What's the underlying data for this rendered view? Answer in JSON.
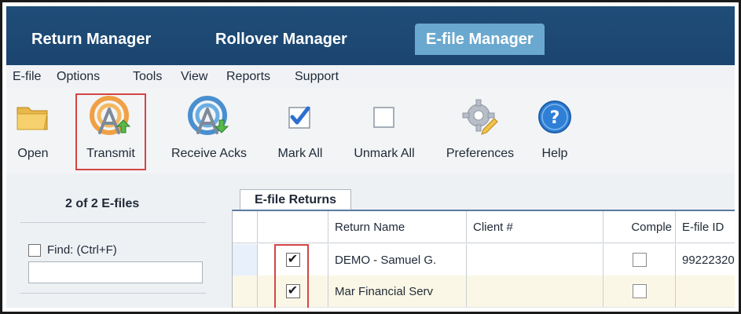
{
  "top_tabs": [
    {
      "label": "Return Manager"
    },
    {
      "label": "Rollover Manager"
    },
    {
      "label": "E-file Manager"
    }
  ],
  "menu": [
    {
      "label": "E-file"
    },
    {
      "label": "Options"
    },
    {
      "label": "Tools"
    },
    {
      "label": "View"
    },
    {
      "label": "Reports"
    },
    {
      "label": "Support"
    }
  ],
  "toolbar": [
    {
      "label": "Open",
      "icon": "folder-icon"
    },
    {
      "label": "Transmit",
      "icon": "transmit-icon"
    },
    {
      "label": "Receive Acks",
      "icon": "receive-acks-icon"
    },
    {
      "label": "Mark All",
      "icon": "checkmark-icon"
    },
    {
      "label": "Unmark All",
      "icon": "empty-checkbox-icon"
    },
    {
      "label": "Preferences",
      "icon": "gear-pencil-icon"
    },
    {
      "label": "Help",
      "icon": "help-icon"
    }
  ],
  "left_pane": {
    "count_label": "2 of 2  E-files",
    "find_label": "Find: (Ctrl+F)",
    "find_value": ""
  },
  "grid": {
    "tab_label": "E-file Returns",
    "columns": [
      "",
      "Return Name",
      "Client #",
      "Comple",
      "E-file ID"
    ],
    "rows": [
      {
        "selected": true,
        "return_name": "DEMO - Samuel G.",
        "client": "",
        "complete": false,
        "efile_id": "99222320"
      },
      {
        "selected": true,
        "return_name": "Mar Financial Serv",
        "client": "",
        "complete": false,
        "efile_id": ""
      }
    ]
  },
  "colors": {
    "topbar": "#1f4d78",
    "active_tab": "#6aa8cf",
    "highlight": "#d34545"
  }
}
